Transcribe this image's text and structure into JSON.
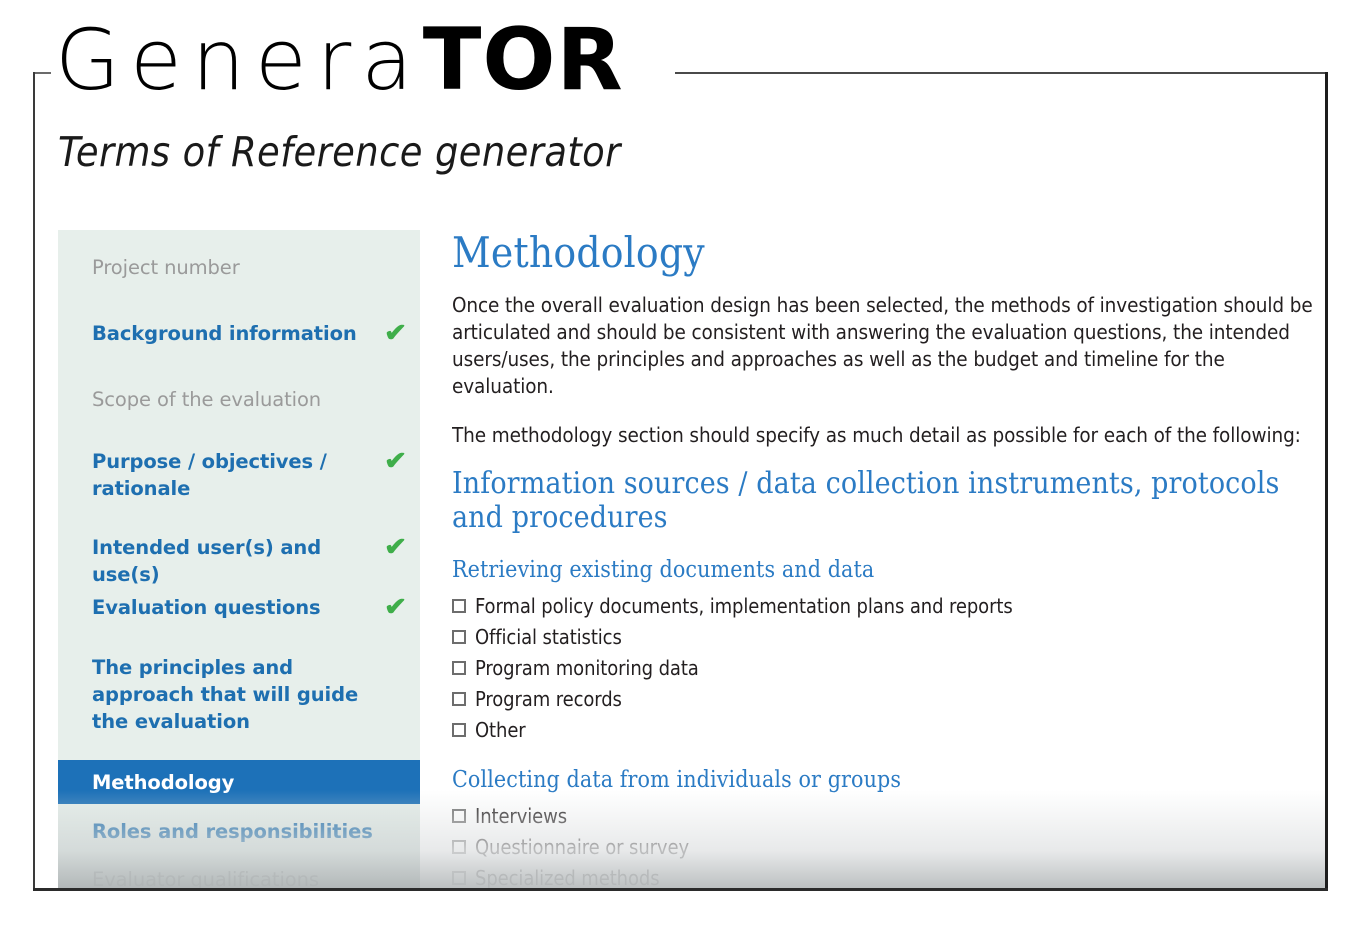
{
  "brand": {
    "logo_light": "Genera",
    "logo_bold": "TOR",
    "subtitle": "Terms of Reference generator",
    "accent_blue": "#2b7bc4",
    "active_blue": "#1d71b8",
    "check_green": "#3fae4a",
    "sidebar_bg": "#e7efeb"
  },
  "sidebar": {
    "items": [
      {
        "label": "Project number",
        "state": "inactive",
        "completed": false
      },
      {
        "label": "Background information",
        "state": "done",
        "completed": true
      },
      {
        "label": "Scope of the evaluation",
        "state": "inactive",
        "completed": false
      },
      {
        "label": "Purpose / objectives / rationale",
        "state": "done",
        "completed": true
      },
      {
        "label": "Intended user(s) and use(s)",
        "state": "done",
        "completed": true
      },
      {
        "label": "Evaluation questions",
        "state": "done",
        "completed": true
      },
      {
        "label": "The principles and approach that will guide the evaluation",
        "state": "pending",
        "completed": false
      },
      {
        "label": "Methodology",
        "state": "active",
        "completed": false
      },
      {
        "label": "Roles and responsibilities",
        "state": "pending",
        "completed": false
      },
      {
        "label": "Evaluator qualifications",
        "state": "inactive",
        "completed": false
      }
    ],
    "check_glyph": "✔"
  },
  "content": {
    "title": "Methodology",
    "paragraphs": [
      "Once the overall evaluation design has been selected, the methods of investigation should be articulated and should be consistent with answering the evaluation questions, the intended users/uses, the principles and approaches as well as the budget and timeline for the evaluation.",
      "The methodology section should specify as much detail as possible for each of the following:"
    ],
    "section_heading": "Information sources / data collection instruments, protocols and procedures",
    "groups": [
      {
        "heading": "Retrieving existing documents and data",
        "options": [
          {
            "label": "Formal policy documents, implementation plans and reports",
            "checked": false
          },
          {
            "label": "Official statistics",
            "checked": false
          },
          {
            "label": "Program monitoring data",
            "checked": false
          },
          {
            "label": "Program records",
            "checked": false
          },
          {
            "label": "Other",
            "checked": false
          }
        ]
      },
      {
        "heading": "Collecting data from individuals or groups",
        "options": [
          {
            "label": "Interviews",
            "checked": false
          },
          {
            "label": "Questionnaire or survey",
            "checked": false
          },
          {
            "label": "Specialized methods",
            "checked": false
          }
        ]
      }
    ]
  }
}
